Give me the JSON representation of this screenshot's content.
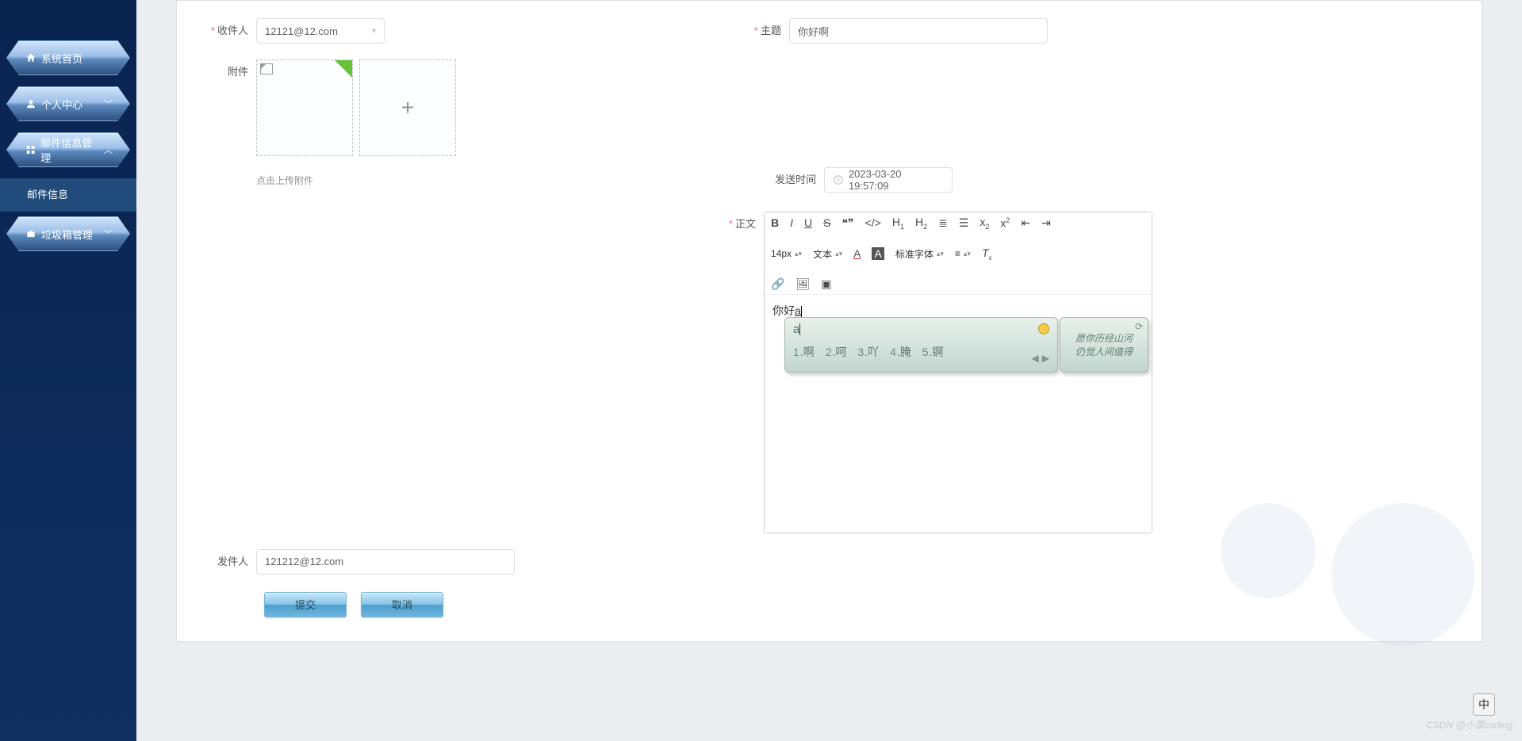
{
  "sidebar": {
    "items": [
      {
        "label": "系统首页",
        "icon": "home-icon",
        "expandable": false
      },
      {
        "label": "个人中心",
        "icon": "user-icon",
        "expandable": true,
        "expanded": false
      },
      {
        "label": "邮件信息管理",
        "icon": "grid-icon",
        "expandable": true,
        "expanded": true,
        "children": [
          {
            "label": "邮件信息",
            "active": true
          }
        ]
      },
      {
        "label": "垃圾箱管理",
        "icon": "trash-icon",
        "expandable": true,
        "expanded": false
      }
    ]
  },
  "form": {
    "recipient_label": "收件人",
    "recipient_value": "12121@12.com",
    "subject_label": "主题",
    "subject_value": "你好啊",
    "attachment_label": "附件",
    "upload_hint": "点击上传附件",
    "send_time_label": "发送时间",
    "send_time_value": "2023-03-20 19:57:09",
    "body_label": "正文",
    "sender_label": "发件人",
    "sender_value": "121212@12.com",
    "submit_label": "提交",
    "cancel_label": "取消"
  },
  "editor": {
    "font_size": "14px",
    "text_style": "文本",
    "font_family": "标准字体",
    "content_prefix": "你好",
    "content_typed": "a"
  },
  "ime": {
    "typed": "a",
    "candidates": [
      {
        "n": "1",
        "w": "啊"
      },
      {
        "n": "2",
        "w": "呵"
      },
      {
        "n": "3",
        "w": "吖"
      },
      {
        "n": "4",
        "w": "腌"
      },
      {
        "n": "5",
        "w": "锕"
      }
    ],
    "script_text": "愿你历经山河\n仍觉人间值得"
  },
  "indicator": "中",
  "watermark": "CSDN @小菜coding"
}
